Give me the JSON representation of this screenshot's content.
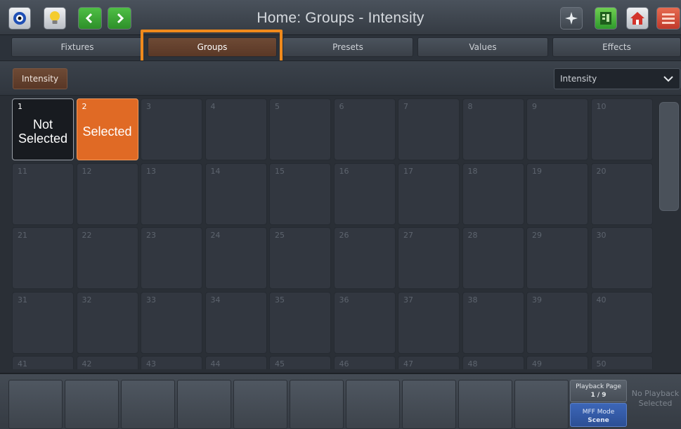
{
  "titlebar": {
    "title": "Home: Groups - Intensity",
    "left_buttons": [
      "eye-icon",
      "bulb-icon",
      "back-arrow-icon",
      "forward-arrow-icon"
    ],
    "right_buttons": [
      "sparkle-icon",
      "palette-icon",
      "home-icon",
      "menu-icon"
    ]
  },
  "tabs": [
    {
      "label": "Fixtures",
      "active": false
    },
    {
      "label": "Groups",
      "active": true
    },
    {
      "label": "Presets",
      "active": false
    },
    {
      "label": "Values",
      "active": false
    },
    {
      "label": "Effects",
      "active": false
    }
  ],
  "filter": {
    "chip_label": "Intensity",
    "dropdown_value": "Intensity"
  },
  "grid": {
    "cells": [
      {
        "num": "1",
        "label": "Not Selected",
        "state": "not-selected"
      },
      {
        "num": "2",
        "label": "Selected",
        "state": "selected"
      },
      {
        "num": "3"
      },
      {
        "num": "4"
      },
      {
        "num": "5"
      },
      {
        "num": "6"
      },
      {
        "num": "7"
      },
      {
        "num": "8"
      },
      {
        "num": "9"
      },
      {
        "num": "10"
      },
      {
        "num": "11"
      },
      {
        "num": "12"
      },
      {
        "num": "13"
      },
      {
        "num": "14"
      },
      {
        "num": "15"
      },
      {
        "num": "16"
      },
      {
        "num": "17"
      },
      {
        "num": "18"
      },
      {
        "num": "19"
      },
      {
        "num": "20"
      },
      {
        "num": "21"
      },
      {
        "num": "22"
      },
      {
        "num": "23"
      },
      {
        "num": "24"
      },
      {
        "num": "25"
      },
      {
        "num": "26"
      },
      {
        "num": "27"
      },
      {
        "num": "28"
      },
      {
        "num": "29"
      },
      {
        "num": "30"
      },
      {
        "num": "31"
      },
      {
        "num": "32"
      },
      {
        "num": "33"
      },
      {
        "num": "34"
      },
      {
        "num": "35"
      },
      {
        "num": "36"
      },
      {
        "num": "37"
      },
      {
        "num": "38"
      },
      {
        "num": "39"
      },
      {
        "num": "40"
      },
      {
        "num": "41"
      },
      {
        "num": "42"
      },
      {
        "num": "43"
      },
      {
        "num": "44"
      },
      {
        "num": "45"
      },
      {
        "num": "46"
      },
      {
        "num": "47"
      },
      {
        "num": "48"
      },
      {
        "num": "49"
      },
      {
        "num": "50"
      }
    ]
  },
  "playback": {
    "page_label": "Playback Page",
    "page_value": "1 / 9",
    "mff_label": "MFF Mode",
    "mff_value": "Scene",
    "no_playback": "No Playback Selected"
  },
  "colors": {
    "accent_orange": "#f08a1c",
    "selected_orange": "#e06a25",
    "active_tab_brown": "#6e4a35",
    "mff_blue": "#3c66b8"
  }
}
